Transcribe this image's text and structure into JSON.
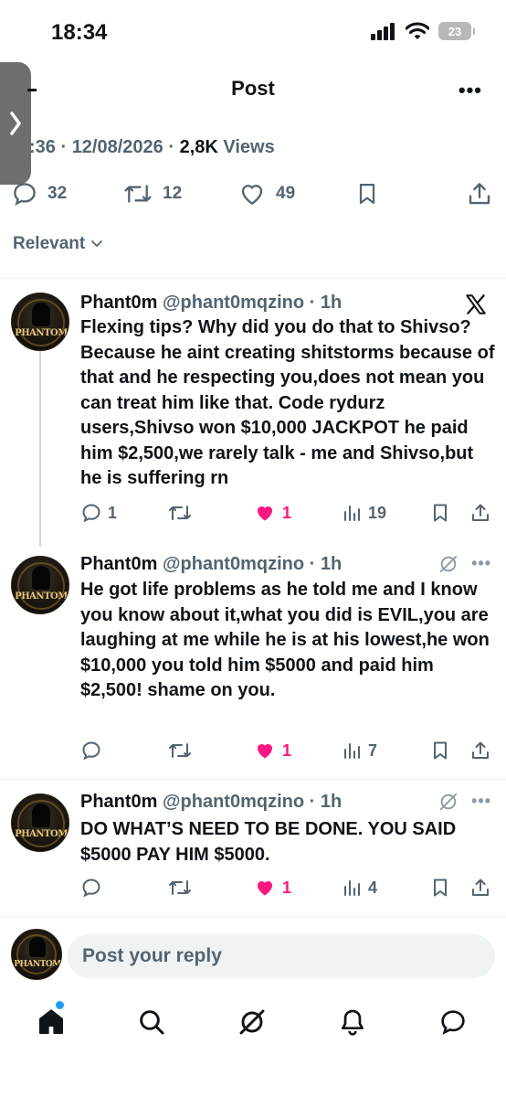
{
  "status_bar": {
    "time": "18:34",
    "battery": "23"
  },
  "header": {
    "title": "Post"
  },
  "post": {
    "time_fragment": ":36",
    "date": "12/08/2026",
    "views_count": "2,8K",
    "views_label": "Views",
    "replies": "32",
    "reposts": "12",
    "likes": "49"
  },
  "sort": {
    "label": "Relevant"
  },
  "replies": [
    {
      "name": "Phant0m",
      "handle": "@phant0mqzino",
      "time": "1h",
      "text": "Flexing tips? Why did you do that to Shivso? Because he aint creating shitstorms because of that and he respecting you,does not mean you can treat him like that. Code rydurz users,Shivso won $10,000 JACKPOT he paid him $2,500,we rarely talk - me and Shivso,but he is suffering rn",
      "reply_count": "1",
      "repost_count": "",
      "like_count": "1",
      "view_count": "19"
    },
    {
      "name": "Phant0m",
      "handle": "@phant0mqzino",
      "time": "1h",
      "text": "He got life problems as he told me and I know you know about it,what you did is EVIL,you are laughing at me while he is at his lowest,he won $10,000 you told him $5000 and paid him $2,500! shame on you.",
      "reply_count": "",
      "repost_count": "",
      "like_count": "1",
      "view_count": "7"
    },
    {
      "name": "Phant0m",
      "handle": "@phant0mqzino",
      "time": "1h",
      "text": "DO WHAT’S NEED TO BE DONE. YOU SAID $5000 PAY HIM $5000.",
      "reply_count": "",
      "repost_count": "",
      "like_count": "1",
      "view_count": "4"
    }
  ],
  "avatar_text": "PHANTOM",
  "compose": {
    "placeholder": "Post your reply"
  },
  "colors": {
    "like": "#f91880",
    "accent": "#1d9bf0",
    "muted": "#536471"
  }
}
